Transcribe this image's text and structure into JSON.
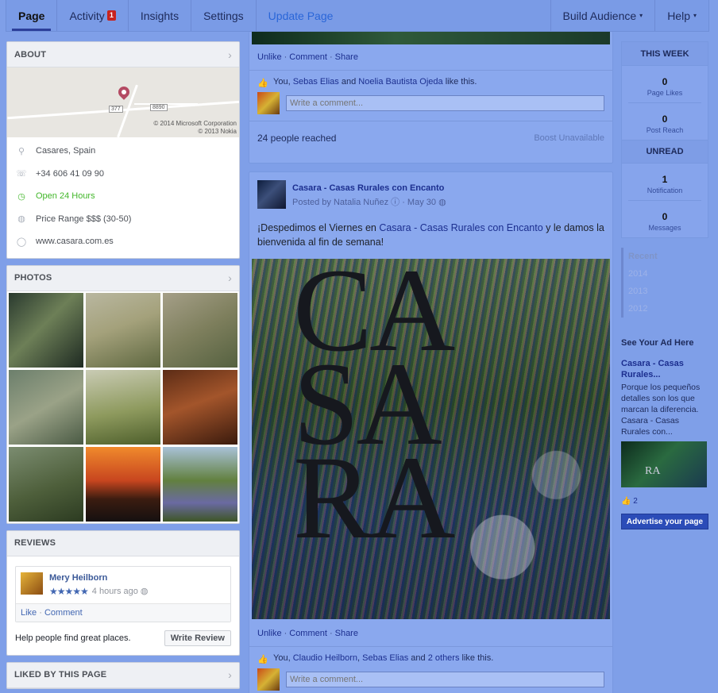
{
  "nav": {
    "items": [
      {
        "label": "Page",
        "active": true
      },
      {
        "label": "Activity",
        "badge": "1"
      },
      {
        "label": "Insights"
      },
      {
        "label": "Settings"
      },
      {
        "label": "Update Page"
      }
    ],
    "right": [
      {
        "label": "Build Audience",
        "caret": "▾"
      },
      {
        "label": "Help",
        "caret": "▾"
      }
    ]
  },
  "about": {
    "title": "ABOUT",
    "map": {
      "copyright": "© 2014 Microsoft Corporation",
      "copyright2": "© 2013 Nokia",
      "road_labels": [
        "377",
        "8890"
      ]
    },
    "rows": [
      {
        "icon": "location-icon",
        "glyph": "⚲",
        "text": "Casares, Spain"
      },
      {
        "icon": "phone-icon",
        "glyph": "☏",
        "text": "+34 606 41 09 90"
      },
      {
        "icon": "clock-icon",
        "glyph": "◷",
        "text": "Open 24 Hours",
        "accent": "#42b72a"
      },
      {
        "icon": "price-icon",
        "glyph": "◍",
        "text": "Price Range $$$ (30-50)"
      },
      {
        "icon": "globe-icon",
        "glyph": "◯",
        "text": "www.casara.com.es"
      }
    ]
  },
  "photos": {
    "title": "PHOTOS"
  },
  "reviews": {
    "title": "REVIEWS",
    "reviewer": "Mery Heilborn",
    "stars": "★★★★★",
    "time": "4 hours ago",
    "like": "Like",
    "comment": "Comment",
    "prompt": "Help people find great places.",
    "button": "Write Review"
  },
  "liked": {
    "title": "LIKED BY THIS PAGE"
  },
  "post1": {
    "actions": {
      "unlike": "Unlike",
      "comment": "Comment",
      "share": "Share"
    },
    "likes": {
      "you": "You,",
      "p1": "Sebas Elias",
      "and": "and",
      "p2": "Noelia Bautista Ojeda",
      "suffix": "like this."
    },
    "comment_placeholder": "Write a comment...",
    "reach": "24 people reached",
    "boost": "Boost Unavailable"
  },
  "post2": {
    "page_name": "Casara - Casas Rurales con Encanto",
    "posted_by": "Posted by Natalia Nuñez",
    "date": "May 30",
    "text_before": "¡Despedimos el Viernes en ",
    "text_link": "Casara - Casas Rurales con Encanto",
    "text_after": " y le damos la bienvenida al fin de semana!",
    "image_lines": [
      "CA",
      "SA",
      "RA"
    ],
    "actions": {
      "unlike": "Unlike",
      "comment": "Comment",
      "share": "Share"
    },
    "likes": {
      "you": "You,",
      "p1": "Claudio Heilborn",
      "sep": ",",
      "p2": "Sebas Elias",
      "and": "and",
      "p3": "2 others",
      "suffix": "like this."
    },
    "comment_placeholder": "Write a comment..."
  },
  "stats": {
    "this_week": "THIS WEEK",
    "page_likes": {
      "num": "0",
      "label": "Page Likes"
    },
    "post_reach": {
      "num": "0",
      "label": "Post Reach"
    },
    "unread": "UNREAD",
    "notification": {
      "num": "1",
      "label": "Notification"
    },
    "messages": {
      "num": "0",
      "label": "Messages"
    }
  },
  "timeline": [
    "Recent",
    "2014",
    "2013",
    "2012"
  ],
  "ad": {
    "heading": "See Your Ad Here",
    "title": "Casara - Casas Rurales...",
    "body": "Porque los pequeños detalles son los que marcan la diferencia. Casara - Casas Rurales con...",
    "image_text": "RA",
    "likes": "2",
    "button": "Advertise your page"
  }
}
